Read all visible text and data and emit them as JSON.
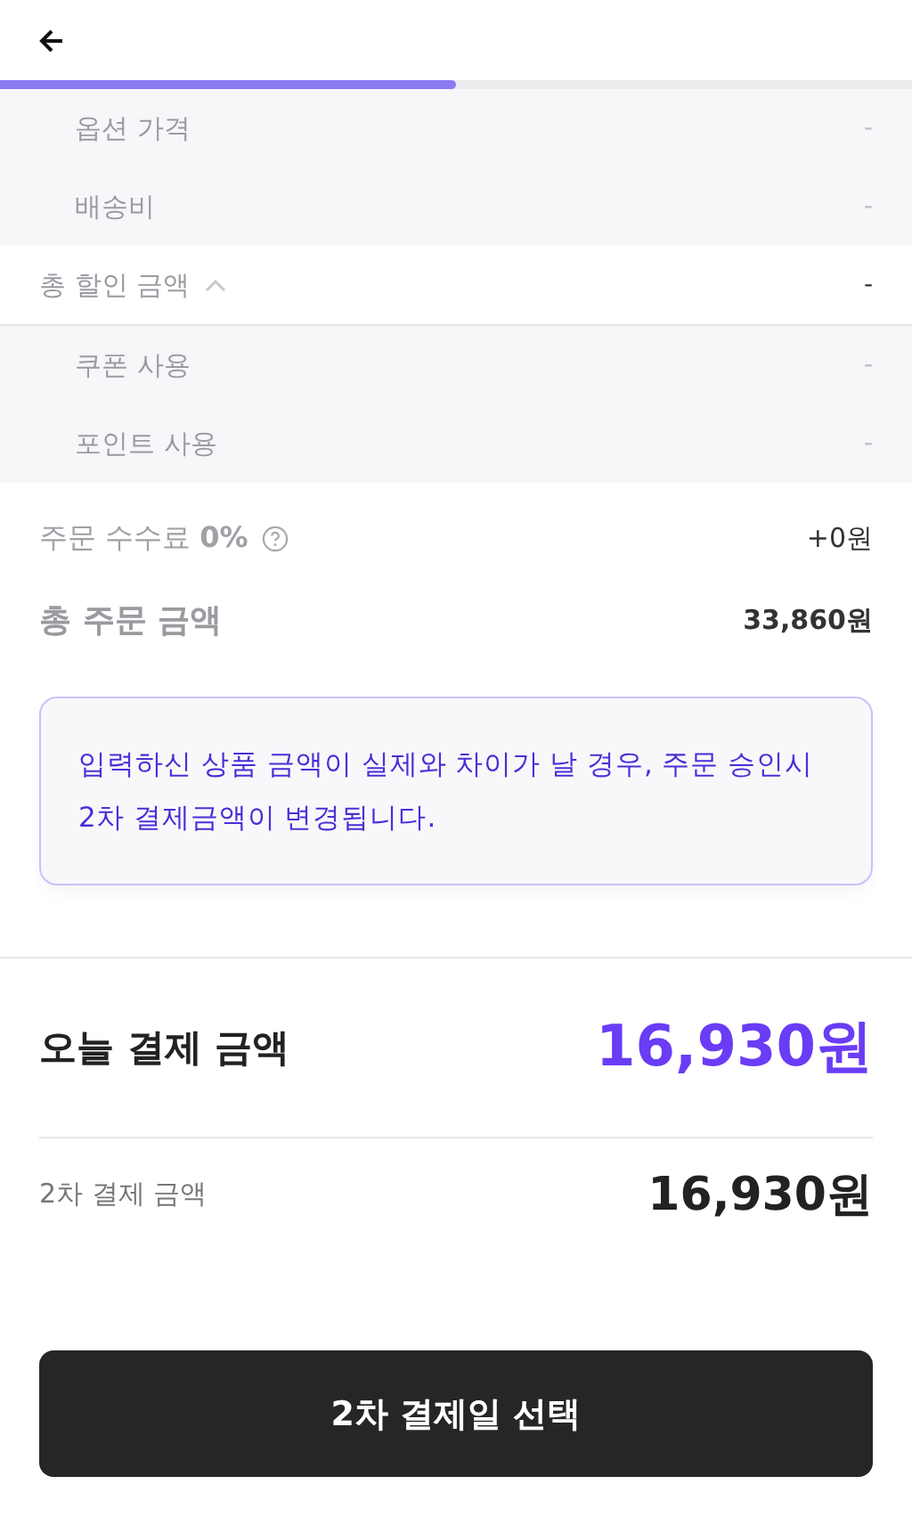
{
  "header": {
    "progress": {
      "level": 0.5
    }
  },
  "items": [
    {
      "kind": "sub",
      "label": "옵션 가격",
      "value": "-"
    },
    {
      "kind": "sub",
      "label": "배송비",
      "value": "-"
    },
    {
      "kind": "group",
      "label": "총 할인 금액",
      "value": "-",
      "expanded": true,
      "children": [
        {
          "kind": "sub",
          "label": "쿠폰 사용",
          "value": "-"
        },
        {
          "kind": "sub",
          "label": "포인트 사용",
          "value": "-"
        }
      ]
    }
  ],
  "fee": {
    "label": "주문 수수료 **0%**",
    "value": "+0원"
  },
  "total": {
    "label": "총 주문 금액",
    "value": "33,860원"
  },
  "notice": "입력하신 상품 금액이 실제와 차이가 날 경우, 주문 승인시 2차 결제금액이 변경됩니다.",
  "today": {
    "label": "오늘 결제 금액",
    "value": "16,930원"
  },
  "second": {
    "label": "2차 결제 금액",
    "value": "16,930원"
  },
  "button": "2차 결제일 선택"
}
